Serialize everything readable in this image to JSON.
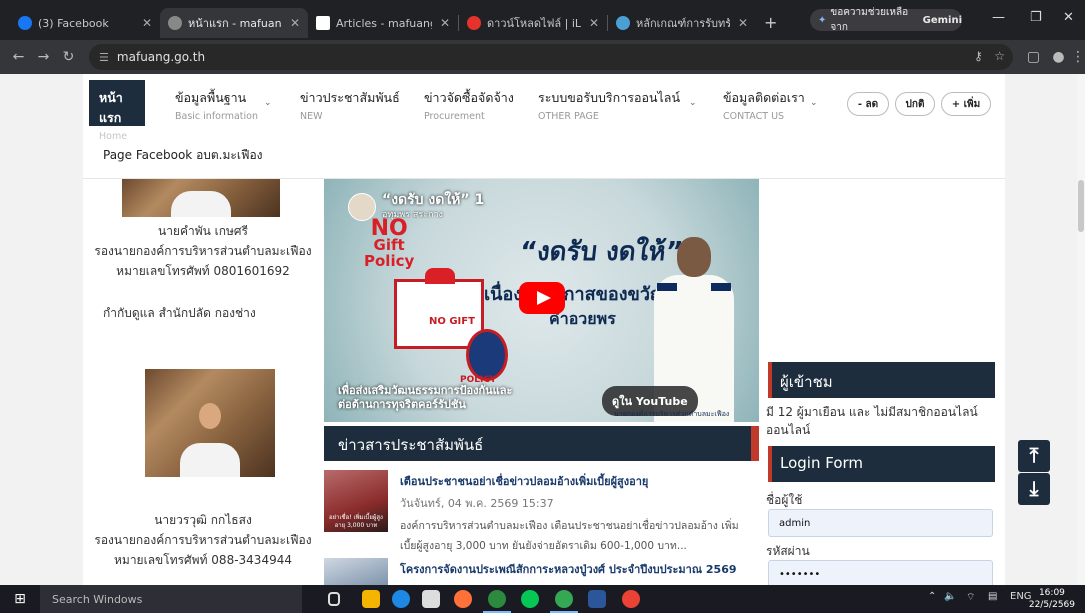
{
  "browser": {
    "tabs": [
      {
        "label": "(3) Facebook",
        "icon": "facebook-icon",
        "color": "#1877f2",
        "active": false
      },
      {
        "label": "หน้าแรก - mafuang",
        "icon": "globe-icon",
        "color": "#888888",
        "active": true
      },
      {
        "label": "Articles - mafuang -",
        "icon": "joomla-icon",
        "color": "#ffffff",
        "active": false
      },
      {
        "label": "ดาวน์โหลดไฟล์ | iLoveP",
        "icon": "heart-icon",
        "color": "#e5322d",
        "active": false
      },
      {
        "label": "หลักเกณฑ์การรับทรัพย์",
        "icon": "site-icon",
        "color": "#4a9fd5",
        "active": false
      }
    ],
    "gemini_label": "ขอความช่วยเหลือจาก",
    "gemini_brand": "Gemini",
    "url": "mafuang.go.th"
  },
  "menu": {
    "items": [
      {
        "title": "หน้าแรก",
        "sub": "Home"
      },
      {
        "title": "ข้อมูลพื้นฐาน",
        "sub": "Basic information"
      },
      {
        "title": "ข่าวประชาสัมพันธ์",
        "sub": "NEW"
      },
      {
        "title": "ข่าวจัดซื้อจัดจ้าง",
        "sub": "Procurement"
      },
      {
        "title": "ระบบขอรับบริการออนไลน์",
        "sub": "OTHER PAGE"
      },
      {
        "title": "ข้อมูลติดต่อเรา",
        "sub": "CONTACT US"
      }
    ],
    "font_buttons": [
      "- ลด",
      "ปกติ",
      "+ เพิ่ม"
    ],
    "facebook_link": "Page Facebook อบต.มะเฟือง"
  },
  "left": {
    "person1_name": "นายคำพัน เกษศรี",
    "person1_title": "รองนายกองค์การบริหารส่วนตำบลมะเฟือง",
    "person1_phone": "หมายเลขโทรศัพท์ 0801601692",
    "person1_duty": "กำกับดูแล สำนักปลัด กองช่าง",
    "person2_name": "นายวรวุฒิ กกไธสง",
    "person2_title": "รองนายกองค์การบริหารส่วนตำบลมะเฟือง",
    "person2_phone": "หมายเลขโทรศัพท์ 088-3434944"
  },
  "video": {
    "title": "“งดรับ งดให้” 1",
    "channel": "อุทุมพร สระกาง",
    "nogift_line1": "NO",
    "nogift_line2": "Gift",
    "nogift_line3": "Policy",
    "headline": "“งดรับ งดให้”",
    "line2": "เนื่องในโอกาสของขวัญเป็น",
    "line3": "คำอวยพร",
    "gift_text": "NO GIFT",
    "policy_text": "POLICY",
    "bottom_line1": "เพื่อส่งเสริมวัฒนธรรมการป้องกันและ",
    "bottom_line2": "ต่อต้านการทุจริตคอร์รัปชัน",
    "watch_label": "ดูใน YouTube",
    "credit": "นายกองค์การบริหารส่วนตำบลมะเฟือง"
  },
  "news": {
    "header": "ข่าวสารประชาสัมพันธ์",
    "items": [
      {
        "title": "เตือนประชาชนอย่าเชื่อข่าวปลอมอ้างเพิ่มเบี้ยผู้สูงอายุ",
        "date": "วันจันทร์, 04 พ.ค. 2569 15:37",
        "body": "องค์การบริหารส่วนตำบลมะเฟือง เตือนประชาชนอย่าเชื่อข่าวปลอมอ้าง เพิ่มเบี้ยผู้สูงอายุ 3,000 บาท ยันยังจ่ายอัตราเดิม 600-1,000 บาท...",
        "thumb_caption": "อย่าเชื่อ! เพิ่มเบี้ยผู้สูงอายุ 3,000 บาท"
      },
      {
        "title": "โครงการจัดงานประเพณีสักการะหลวงปู่วงศ์ ประจำปีงบประมาณ 2569"
      }
    ]
  },
  "sidebar": {
    "visitors_header": "ผู้เข้าชม",
    "visitors_text": "มี 12 ผู้มาเยือน และ ไม่มีสมาชิกออนไลน์ออนไลน์",
    "login_header": "Login Form",
    "username_label": "ชื่อผู้ใช้",
    "username_value": "admin",
    "password_label": "รหัสผ่าน",
    "password_value": "•••••••"
  },
  "taskbar": {
    "search_placeholder": "Search Windows",
    "lang": "ENG",
    "time": "16:09",
    "date": "22/5/2569"
  },
  "colors": {
    "navy": "#1e2d3d",
    "accent_red": "#c0392b",
    "chrome_dark": "#202124"
  }
}
